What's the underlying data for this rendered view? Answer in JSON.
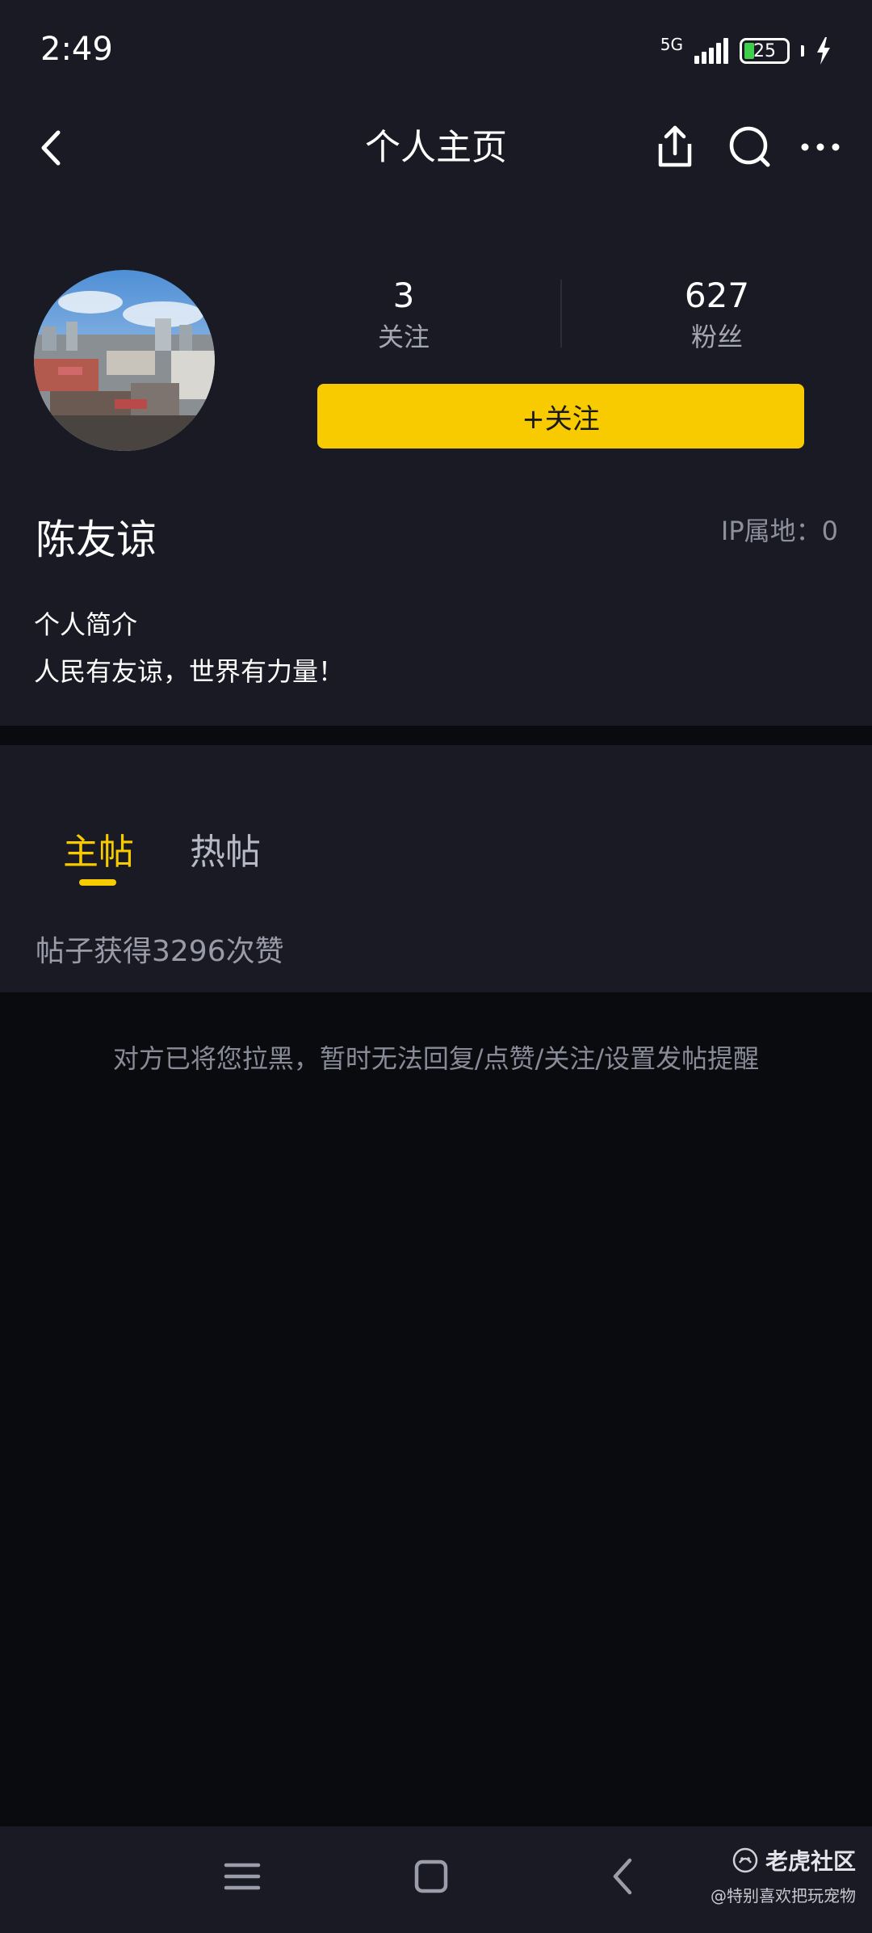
{
  "status_bar": {
    "time": "2:49",
    "network": "5G",
    "battery": "25"
  },
  "nav": {
    "title": "个人主页",
    "icons": [
      "back-icon",
      "share-icon",
      "search-icon",
      "more-icon"
    ]
  },
  "profile": {
    "following_count": "3",
    "following_label": "关注",
    "fans_count": "627",
    "fans_label": "粉丝",
    "follow_button": "+关注",
    "username": "陈友谅",
    "ip_location": "IP属地：0",
    "bio_title": "个人简介",
    "bio_text": "人民有友谅，世界有力量！"
  },
  "tabs": [
    {
      "label": "主帖",
      "active": true
    },
    {
      "label": "热帖",
      "active": false
    }
  ],
  "likes_summary": "帖子获得3296次赞",
  "blocked_notice": "对方已将您拉黑，暂时无法回复/点赞/关注/设置发帖提醒",
  "system_nav": {
    "icons": [
      "menu-icon",
      "home-icon",
      "back-icon"
    ]
  },
  "watermark": {
    "brand": "老虎社区",
    "user": "@特别喜欢把玩宠物"
  },
  "colors": {
    "accent": "#f8ca00",
    "panel": "#191a24",
    "background": "#0a0b0f"
  }
}
